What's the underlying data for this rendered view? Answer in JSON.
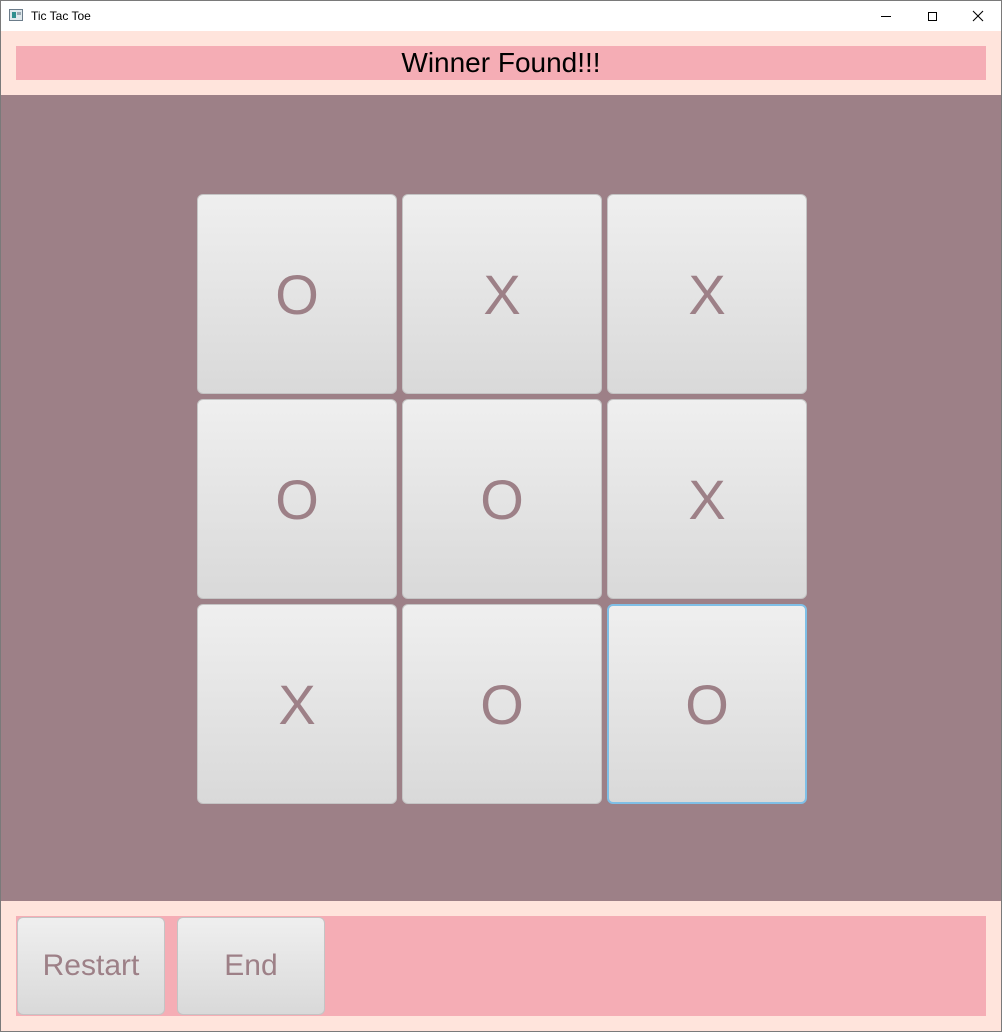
{
  "window": {
    "title": "Tic Tac Toe"
  },
  "status": {
    "message": "Winner Found!!!"
  },
  "board": {
    "cells": [
      "O",
      "X",
      "X",
      "O",
      "O",
      "X",
      "X",
      "O",
      "O"
    ],
    "focused_cell": 8
  },
  "controls": {
    "restart_label": "Restart",
    "end_label": "End"
  },
  "colors": {
    "frame_background": "#ffe4dc",
    "status_background": "#f5adb5",
    "board_background": "#9d8087",
    "mark_color": "#9d8087",
    "focus_border": "#7fbfe6"
  },
  "icons": {
    "app": "app-icon",
    "minimize": "minimize-icon",
    "maximize": "maximize-icon",
    "close": "close-icon"
  }
}
